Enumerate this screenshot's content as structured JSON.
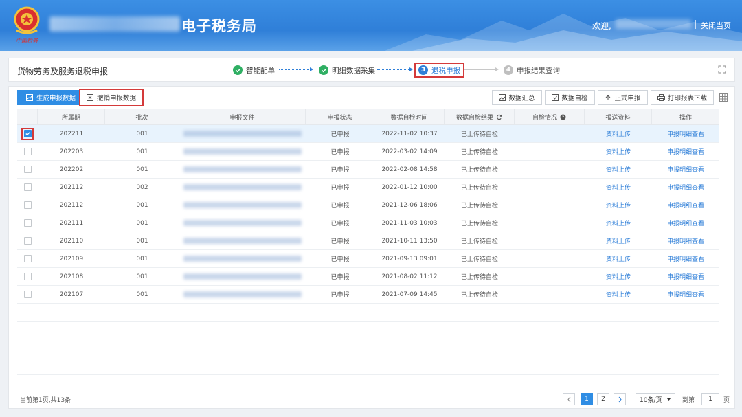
{
  "header": {
    "title": "电子税务局",
    "welcome": "欢迎,",
    "close_label": "关闭当页",
    "emblem_text": "中国税务"
  },
  "steps": {
    "page_title": "货物劳务及服务退税申报",
    "items": [
      {
        "label": "智能配单",
        "state": "done"
      },
      {
        "label": "明细数据采集",
        "state": "done"
      },
      {
        "label": "退税申报",
        "state": "current",
        "num": "3"
      },
      {
        "label": "申报结果查询",
        "state": "pending",
        "num": "4"
      }
    ]
  },
  "toolbar": {
    "generate_label": "生成申报数据",
    "revoke_label": "撤销申报数据",
    "summary_label": "数据汇总",
    "selfcheck_label": "数据自检",
    "formal_label": "正式申报",
    "print_label": "打印报表下载"
  },
  "table": {
    "headers": [
      "所属期",
      "批次",
      "申报文件",
      "申报状态",
      "数据自检时间",
      "数据自检结果",
      "自检情况",
      "报送资料",
      "操作"
    ],
    "rows": [
      {
        "period": "202211",
        "batch": "001",
        "status": "已申报",
        "time": "2022-11-02 10:37",
        "result": "已上传待自检",
        "upload": "资料上传",
        "action": "申报明细查看",
        "checked": true
      },
      {
        "period": "202203",
        "batch": "001",
        "status": "已申报",
        "time": "2022-03-02 14:09",
        "result": "已上传待自检",
        "upload": "资料上传",
        "action": "申报明细查看",
        "checked": false
      },
      {
        "period": "202202",
        "batch": "001",
        "status": "已申报",
        "time": "2022-02-08 14:58",
        "result": "已上传待自检",
        "upload": "资料上传",
        "action": "申报明细查看",
        "checked": false
      },
      {
        "period": "202112",
        "batch": "002",
        "status": "已申报",
        "time": "2022-01-12 10:00",
        "result": "已上传待自检",
        "upload": "资料上传",
        "action": "申报明细查看",
        "checked": false
      },
      {
        "period": "202112",
        "batch": "001",
        "status": "已申报",
        "time": "2021-12-06 18:06",
        "result": "已上传待自检",
        "upload": "资料上传",
        "action": "申报明细查看",
        "checked": false
      },
      {
        "period": "202111",
        "batch": "001",
        "status": "已申报",
        "time": "2021-11-03 10:03",
        "result": "已上传待自检",
        "upload": "资料上传",
        "action": "申报明细查看",
        "checked": false
      },
      {
        "period": "202110",
        "batch": "001",
        "status": "已申报",
        "time": "2021-10-11 13:50",
        "result": "已上传待自检",
        "upload": "资料上传",
        "action": "申报明细查看",
        "checked": false
      },
      {
        "period": "202109",
        "batch": "001",
        "status": "已申报",
        "time": "2021-09-13 09:01",
        "result": "已上传待自检",
        "upload": "资料上传",
        "action": "申报明细查看",
        "checked": false
      },
      {
        "period": "202108",
        "batch": "001",
        "status": "已申报",
        "time": "2021-08-02 11:12",
        "result": "已上传待自检",
        "upload": "资料上传",
        "action": "申报明细查看",
        "checked": false
      },
      {
        "period": "202107",
        "batch": "001",
        "status": "已申报",
        "time": "2021-07-09 14:45",
        "result": "已上传待自检",
        "upload": "资料上传",
        "action": "申报明细查看",
        "checked": false
      }
    ]
  },
  "footer": {
    "summary": "当前第1页,共13条",
    "pages": [
      "1",
      "2"
    ],
    "page_size": "10条/页",
    "goto_label": "到第",
    "goto_value": "1",
    "goto_suffix": "页"
  },
  "colors": {
    "primary": "#2f8de4",
    "highlight_border": "#d43a3a",
    "done_green": "#2faf63"
  }
}
